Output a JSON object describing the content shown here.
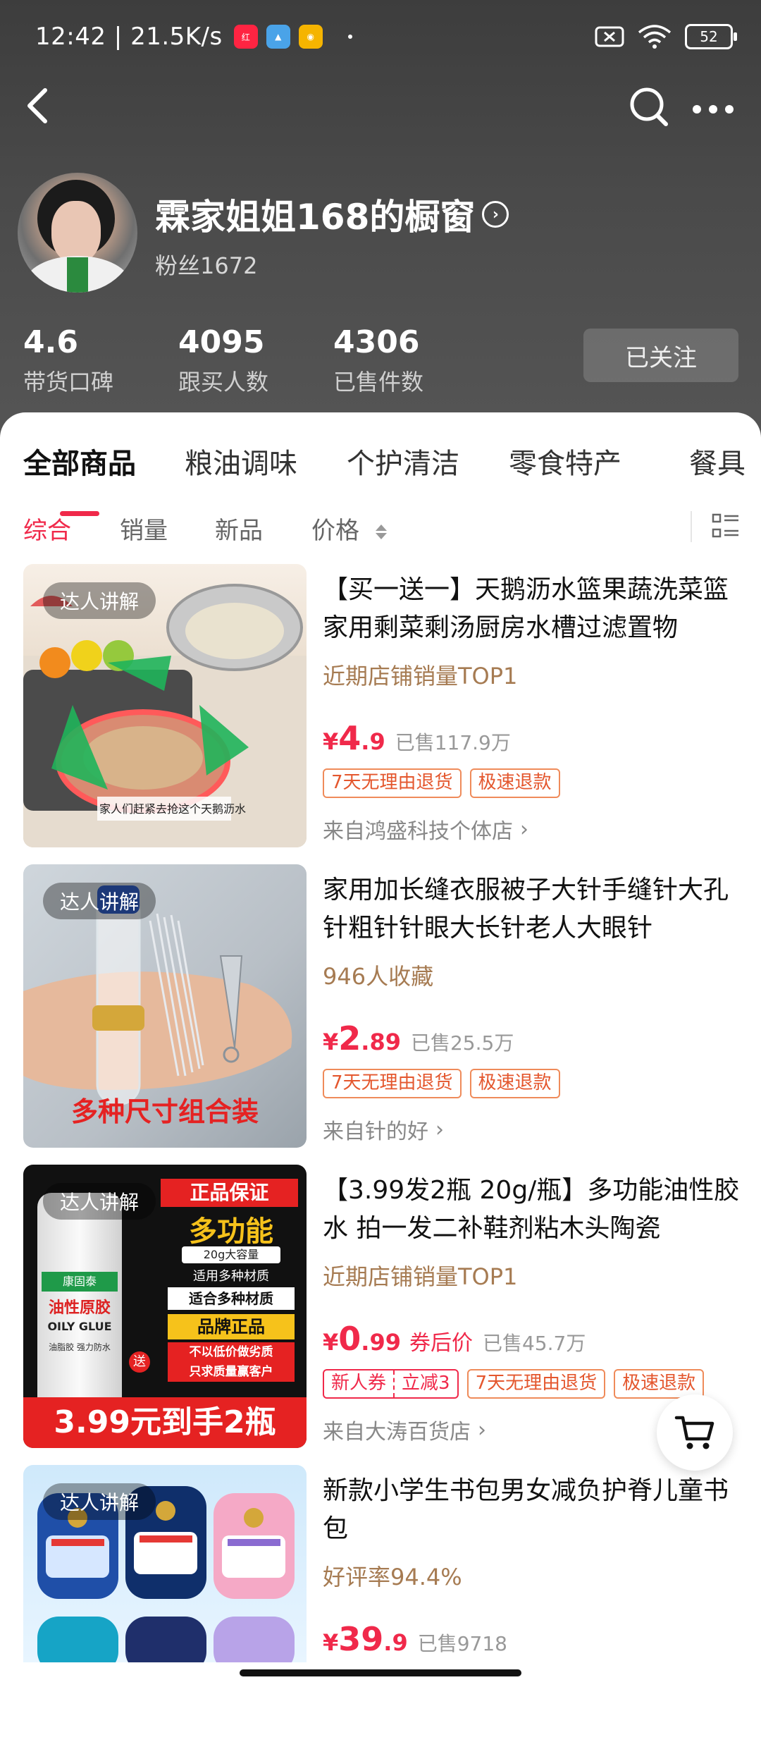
{
  "status_bar": {
    "time": "12:42",
    "net_speed": "21.5K/s",
    "battery": "52"
  },
  "store": {
    "name": "霖家姐姐168的橱窗",
    "fans": "粉丝1672"
  },
  "stats": [
    {
      "value": "4.6",
      "label": "带货口碑"
    },
    {
      "value": "4095",
      "label": "跟买人数"
    },
    {
      "value": "4306",
      "label": "已售件数"
    }
  ],
  "follow_label": "已关注",
  "tabs": [
    "全部商品",
    "粮油调味",
    "个护清洁",
    "零食特产",
    "餐具"
  ],
  "sorts": [
    "综合",
    "销量",
    "新品",
    "价格"
  ],
  "products": [
    {
      "badge": "达人讲解",
      "title": "【买一送一】天鹅沥水篮果蔬洗菜篮家用剩菜剩汤厨房水槽过滤置物",
      "sub": "近期店铺销量TOP1",
      "price_yen": "¥",
      "price_int": "4",
      "price_dec": ".9",
      "after_label": "",
      "sold": "已售117.9万",
      "coupon": [],
      "tags": [
        "7天无理由退货",
        "极速退款"
      ],
      "from": "来自鸿盛科技个体店",
      "thumb_caption": "家人们赶紧去抢这个天鹅沥水"
    },
    {
      "badge": "达人讲解",
      "title": "家用加长缝衣服被子大针手缝针大孔针粗针针眼大长针老人大眼针",
      "sub": "946人收藏",
      "price_yen": "¥",
      "price_int": "2",
      "price_dec": ".89",
      "after_label": "",
      "sold": "已售25.5万",
      "coupon": [],
      "tags": [
        "7天无理由退货",
        "极速退款"
      ],
      "from": "来自针的好",
      "thumb_caption": "多种尺寸组合装"
    },
    {
      "badge": "达人讲解",
      "title": "【3.99发2瓶 20g/瓶】多功能油性胶水 拍一发二补鞋剂粘木头陶瓷",
      "sub": "近期店铺销量TOP1",
      "price_yen": "¥",
      "price_int": "0",
      "price_dec": ".99",
      "after_label": "券后价",
      "sold": "已售45.7万",
      "coupon": [
        "新人券",
        "立减3"
      ],
      "tags": [
        "7天无理由退货",
        "极速退款"
      ],
      "from": "来自大涛百货店",
      "thumb_lines": [
        "正品保证",
        "多功能",
        "20g大容量",
        "适用多种材质",
        "适合多种材质",
        "品牌正品",
        "不以低价做劣质",
        "只求质量赢客户",
        "3.99元到手2瓶"
      ],
      "bottle_labels": [
        "康固泰",
        "油性原胶",
        "OILY GLUE",
        "油脂胶 强力防水",
        "送"
      ]
    },
    {
      "badge": "达人讲解",
      "title": "新款小学生书包男女减负护脊儿童书包",
      "sub": "好评率94.4%",
      "price_yen": "¥",
      "price_int": "39",
      "price_dec": ".9",
      "after_label": "",
      "sold": "已售9718",
      "coupon": [],
      "tags": [],
      "from": ""
    }
  ],
  "colors": {
    "accent": "#f0294a",
    "sub_text": "#a67b52",
    "header_bg": "#444444"
  }
}
